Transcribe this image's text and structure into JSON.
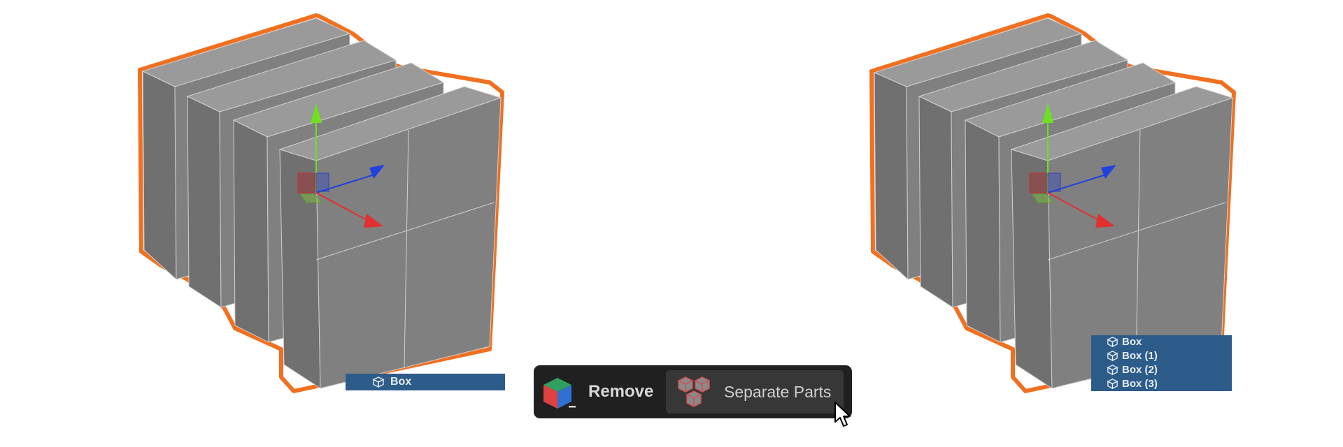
{
  "viewport_left": {
    "outliner": {
      "items": [
        {
          "label": "Box",
          "icon": "box-icon"
        }
      ]
    },
    "gizmo": {
      "icon": "transform-gizmo-icon"
    }
  },
  "viewport_right": {
    "outliner": {
      "items": [
        {
          "label": "Box",
          "icon": "box-icon"
        },
        {
          "label": "Box (1)",
          "icon": "box-icon"
        },
        {
          "label": "Box (2)",
          "icon": "box-icon"
        },
        {
          "label": "Box (3)",
          "icon": "box-icon"
        }
      ]
    },
    "gizmo": {
      "icon": "transform-gizmo-icon"
    }
  },
  "toolbar": {
    "remove": {
      "label": "Remove",
      "icon": "remove-cube-icon"
    },
    "separate_parts": {
      "label": "Separate Parts",
      "icon": "separate-parts-icon"
    }
  },
  "cursor": {
    "icon": "mouse-pointer-icon"
  },
  "colors": {
    "selection_outline": "#f07020",
    "outliner_bg": "#2d5c8a",
    "toolbar_bg": "#202020",
    "button_bg": "#373737",
    "mesh_face": "#808080",
    "axis_x": "#e03030",
    "axis_y": "#6ee020",
    "axis_z": "#2040e0"
  }
}
